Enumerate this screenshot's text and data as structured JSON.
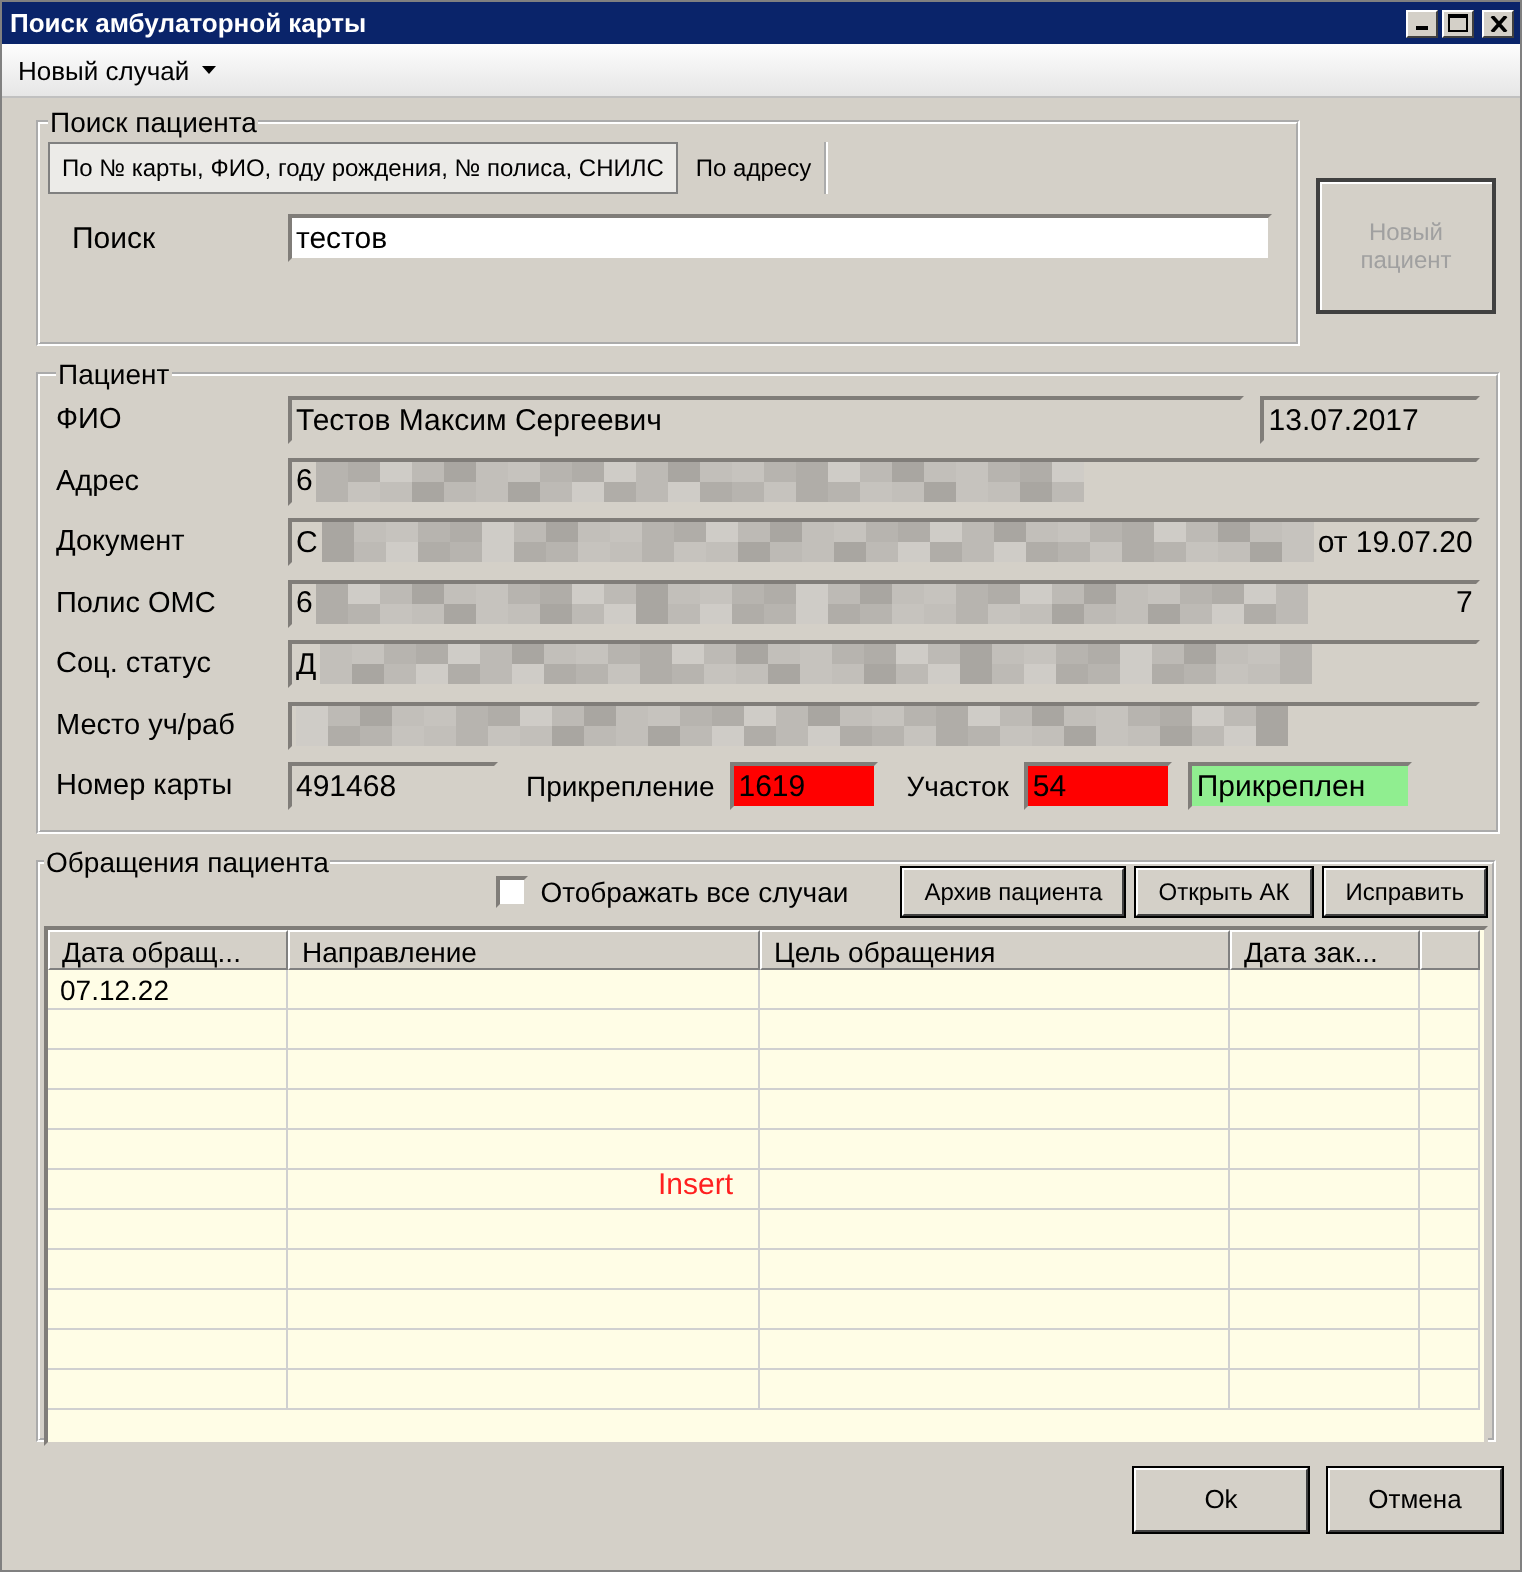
{
  "window": {
    "title": "Поиск амбулаторной карты"
  },
  "menu": [
    {
      "label": "Новый случай",
      "dropdown": true
    }
  ],
  "search_group": {
    "title": "Поиск пациента",
    "search_label": "Поиск",
    "search_value": "тестов",
    "tabs": [
      {
        "label": "По № карты, ФИО, году рождения, № полиса, СНИЛС",
        "selected": true
      },
      {
        "label": "По адресу",
        "selected": false
      }
    ]
  },
  "new_patient_button": {
    "label": "Новый пациент",
    "disabled": true
  },
  "patient": {
    "title": "Пациент",
    "fields": [
      {
        "label": "ФИО",
        "value": "Тестов Максим Сергеевич",
        "extra": "13.07.2017"
      },
      {
        "label": "Адрес",
        "value": "6",
        "redacted": true
      },
      {
        "label": "Документ",
        "value": "С",
        "value_end": "от 19.07.20",
        "redacted": true
      },
      {
        "label": "Полис ОМС",
        "value": "6",
        "value_end": "7",
        "redacted": true
      },
      {
        "label": "Соц. статус",
        "value": "Д",
        "redacted": true
      },
      {
        "label": "Место уч/раб",
        "redacted": true
      }
    ],
    "card_label": "Номер карты",
    "card_value": "491468",
    "status_items": [
      {
        "label": "Прикрепление",
        "value": "1619",
        "color": "#ff0000"
      },
      {
        "label": "Участок",
        "value": "54",
        "color": "#ff0000"
      },
      {
        "value": "Прикреплен",
        "color": "#90ee90"
      }
    ]
  },
  "cases": {
    "title": "Обращения пациента",
    "show_all": {
      "label": "Отображать все случаи",
      "checked": false
    },
    "buttons": [
      "Архив пациента",
      "Открыть АК",
      "Исправить"
    ],
    "table": {
      "columns": [
        "Дата обращ...",
        "Направление",
        "Цель обращения",
        "Дата зак..."
      ],
      "rows": [
        {
          "date": "07.12.22"
        }
      ]
    },
    "overlay_text": "Insert"
  },
  "footer_buttons": [
    "Ok",
    "Отмена"
  ]
}
